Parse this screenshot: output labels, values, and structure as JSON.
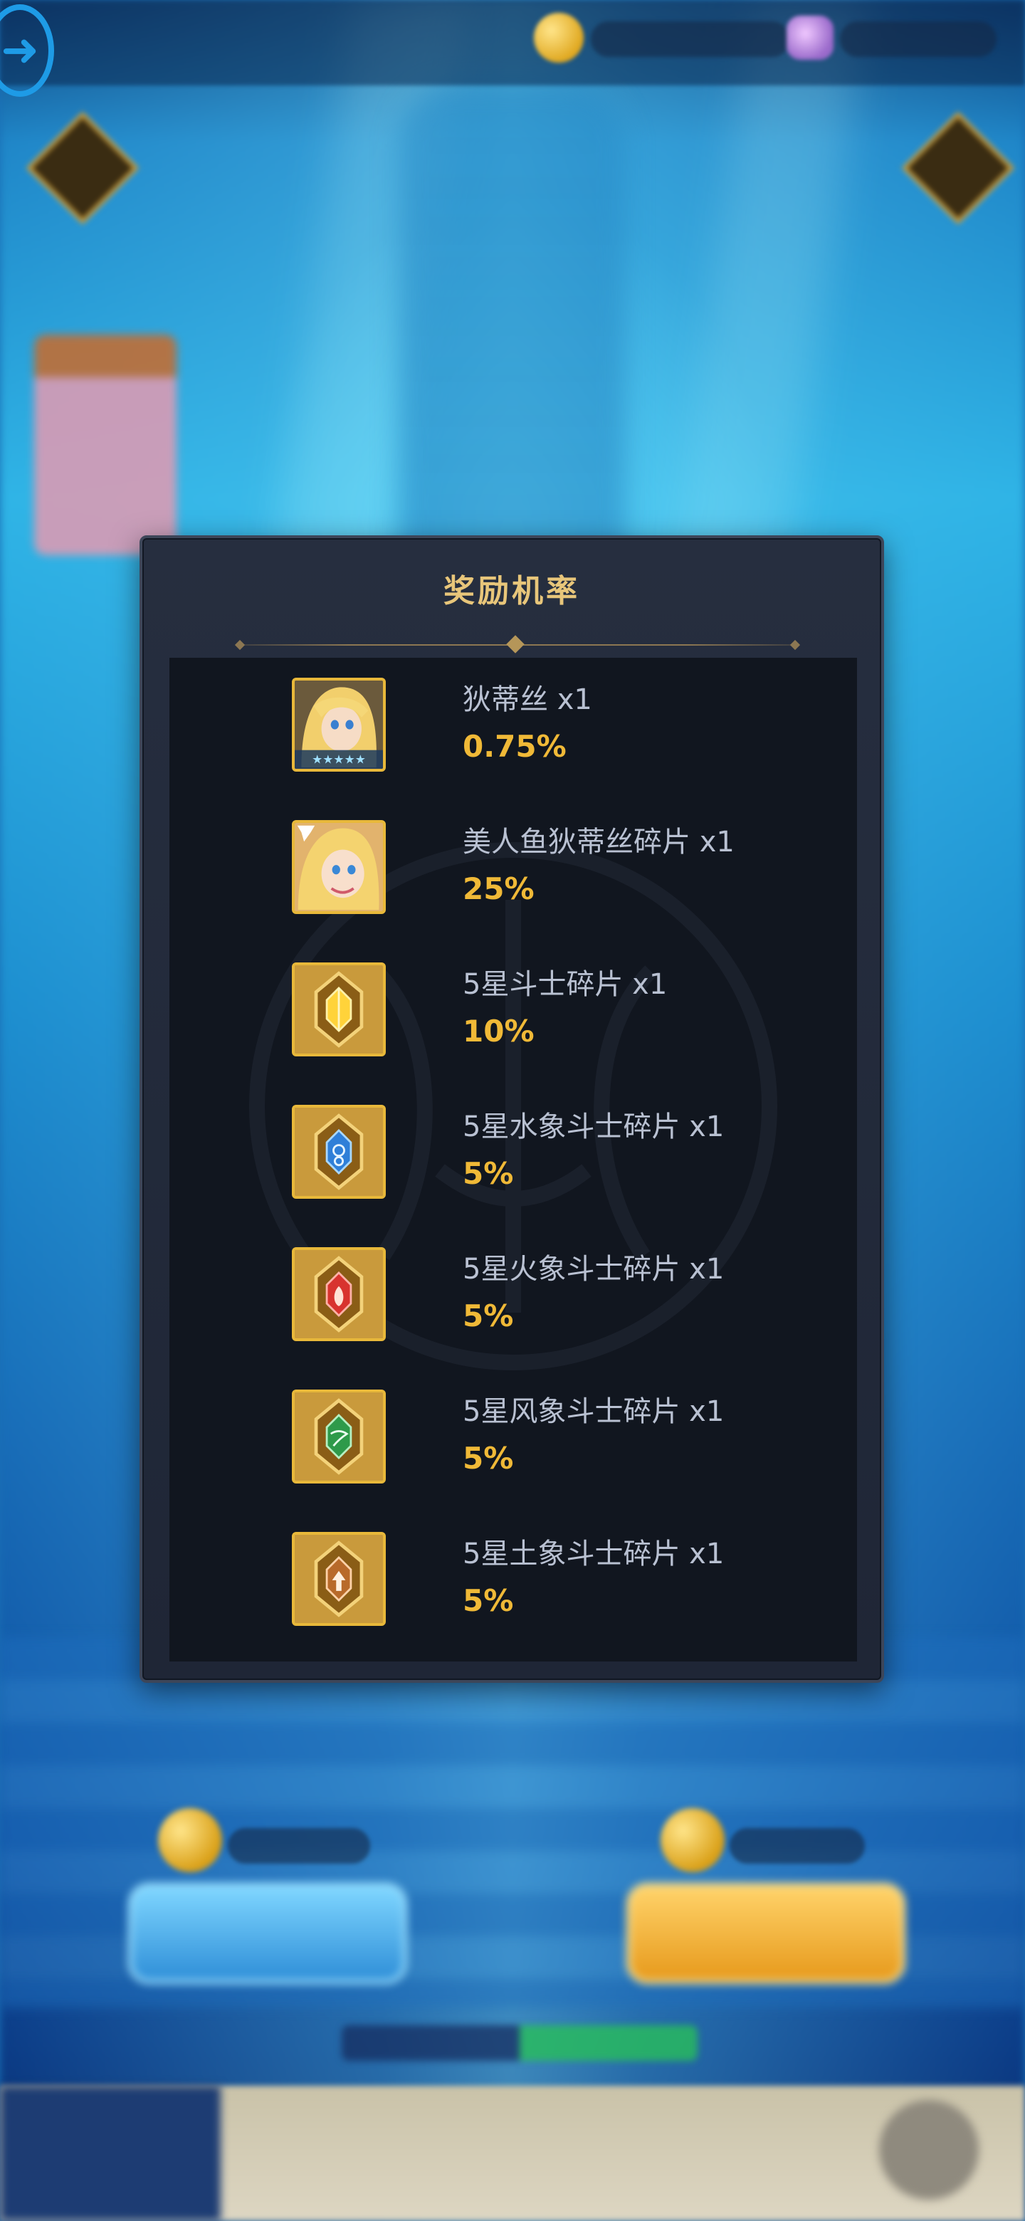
{
  "modal": {
    "title": "奖励机率",
    "rewards": [
      {
        "name": "狄蒂丝 x1",
        "rate": "0.75%",
        "icon": "hero-portrait-icon"
      },
      {
        "name": "美人鱼狄蒂丝碎片 x1",
        "rate": "25%",
        "icon": "hero-shard-portrait-icon"
      },
      {
        "name": "5星斗士碎片 x1",
        "rate": "10%",
        "icon": "gold-crystal-shard-icon"
      },
      {
        "name": "5星水象斗士碎片 x1",
        "rate": "5%",
        "icon": "water-crystal-shard-icon"
      },
      {
        "name": "5星火象斗士碎片 x1",
        "rate": "5%",
        "icon": "fire-crystal-shard-icon"
      },
      {
        "name": "5星风象斗士碎片 x1",
        "rate": "5%",
        "icon": "wind-crystal-shard-icon"
      },
      {
        "name": "5星土象斗士碎片 x1",
        "rate": "5%",
        "icon": "earth-crystal-shard-icon"
      }
    ]
  },
  "colors": {
    "title": "#e8c67a",
    "rate": "#f0b937",
    "name": "#b9c1d2",
    "icon_border": "#e8b83a",
    "water": "#2f7fd8",
    "fire": "#d8332f",
    "wind": "#2e9a4a",
    "earth": "#b86a2a"
  }
}
